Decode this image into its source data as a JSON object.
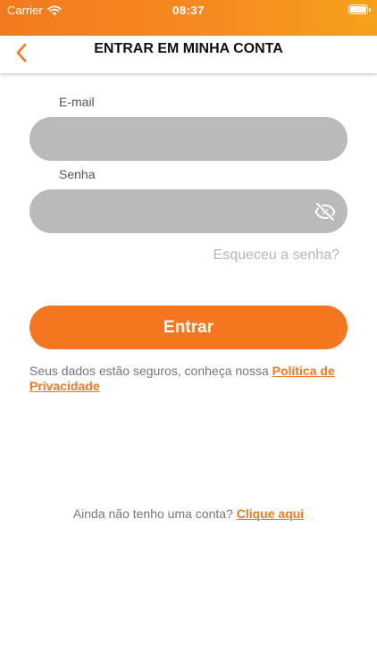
{
  "status_bar": {
    "carrier": "Carrier",
    "time": "08:37"
  },
  "nav": {
    "back_icon": "chevron-left-icon",
    "title": "ENTRAR EM MINHA CONTA"
  },
  "form": {
    "email_label": "E-mail",
    "email_value": "",
    "password_label": "Senha",
    "password_value": "",
    "visibility_icon": "eye-off-icon",
    "forgot_link": "Esqueceu a senha?",
    "submit_label": "Entrar"
  },
  "privacy": {
    "text": "Seus dados estão seguros, conheça nossa",
    "link": "Política de Privacidade"
  },
  "signup": {
    "text": "Ainda não tenho uma conta?",
    "link": "Clique aqui"
  },
  "colors": {
    "accent": "#f47620",
    "field_bg": "#bababa",
    "muted_text": "#777777"
  }
}
